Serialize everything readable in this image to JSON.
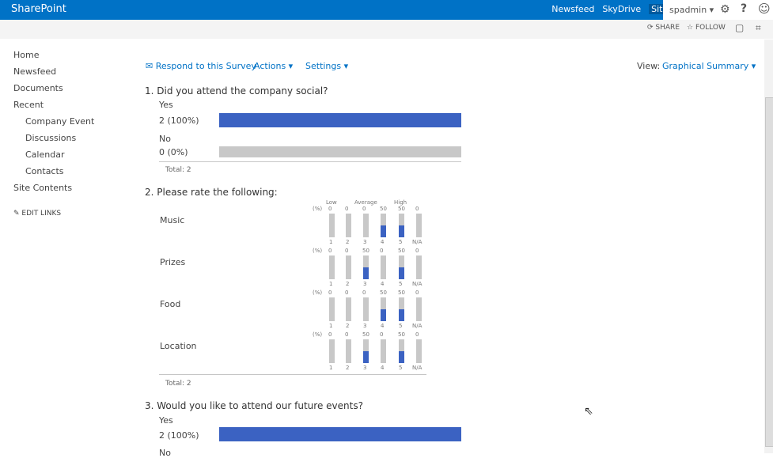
{
  "top": {
    "brand": "SharePoint",
    "links": [
      "Newsfeed",
      "SkyDrive",
      "Sites"
    ],
    "user": "spadmin ▾",
    "gear": "⚙",
    "help": "?",
    "smiley": "☺"
  },
  "suite": {
    "share": "SHARE",
    "follow": "FOLLOW"
  },
  "nav": {
    "items": [
      "Home",
      "Newsfeed",
      "Documents",
      "Recent",
      "Company Event",
      "Discussions",
      "Calendar",
      "Contacts",
      "Site Contents"
    ],
    "edit": "EDIT LINKS"
  },
  "toolbar": {
    "respond": "Respond to this Survey",
    "actions": "Actions ▾",
    "settings": "Settings ▾",
    "view_label": "View:",
    "view_value": "Graphical Summary ▾"
  },
  "q1": {
    "title": "1. Did you attend the company social?",
    "yes": "Yes",
    "yes_val": "2 (100%)",
    "yes_fraction": 1.0,
    "no": "No",
    "no_val": "0 (0%)",
    "no_fraction": 0.0,
    "total": "Total: 2"
  },
  "q2": {
    "title": "2. Please rate the following:",
    "scale_header": {
      "low": "Low",
      "average": "Average",
      "high": "High"
    },
    "pct_label": "(%)",
    "scale_labels": [
      "1",
      "2",
      "3",
      "4",
      "5",
      "N/A"
    ],
    "rows": [
      {
        "label": "Music",
        "percents": [
          0,
          0,
          0,
          50,
          50,
          0
        ]
      },
      {
        "label": "Prizes",
        "percents": [
          0,
          0,
          50,
          0,
          50,
          0
        ]
      },
      {
        "label": "Food",
        "percents": [
          0,
          0,
          0,
          50,
          50,
          0
        ]
      },
      {
        "label": "Location",
        "percents": [
          0,
          0,
          50,
          0,
          50,
          0
        ]
      }
    ],
    "total": "Total: 2"
  },
  "q3": {
    "title": "3. Would you like to attend our future events?",
    "yes": "Yes",
    "yes_val": "2 (100%)",
    "yes_fraction": 1.0,
    "no_partial": "No"
  },
  "colors": {
    "topbar": "#0072c6",
    "bar_fill": "#3b62c2",
    "bar_empty": "#c8c8c8"
  }
}
